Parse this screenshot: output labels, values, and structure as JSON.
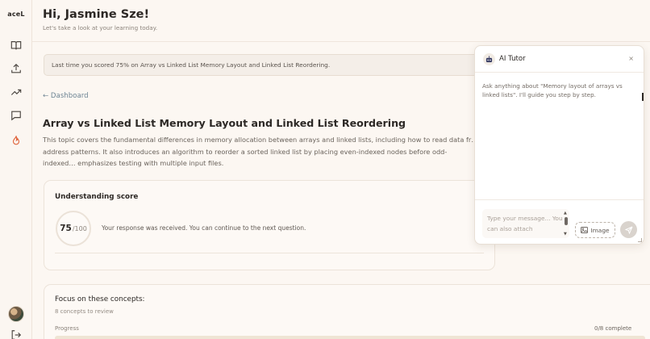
{
  "app": {
    "logo": "aceL"
  },
  "header": {
    "greeting": "Hi, Jasmine Sze!",
    "subtitle": "Let's take a look at your learning today."
  },
  "notice": "Last time you scored 75% on Array vs Linked List Memory Layout and Linked List Reordering.",
  "back_link": "← Dashboard",
  "topic": {
    "title": "Array vs Linked List Memory Layout and Linked List Reordering",
    "description": "This topic covers the fundamental differences in memory allocation between arrays and linked lists, including how to read data fr… address patterns. It also introduces an algorithm to reorder a sorted linked list by placing even-indexed nodes before odd-indexed… emphasizes testing with multiple input files."
  },
  "score_card": {
    "title": "Understanding score",
    "score": "75",
    "max": "/100",
    "message": "Your response was received. You can continue to the next question."
  },
  "concepts": {
    "title": "Focus on these concepts:",
    "subtitle": "8 concepts to review",
    "progress_label": "Progress",
    "progress_count": "0/8 complete",
    "progress_fraction": 0
  },
  "tutor": {
    "title": "AI Tutor",
    "close": "×",
    "intro": "Ask anything about \"Memory layout of arrays vs linked lists\". I'll guide you step by step.",
    "input_placeholder": "Type your message... You can also attach",
    "image_label": "Image"
  },
  "icons": [
    "book-icon",
    "upload-icon",
    "trending-icon",
    "chat-icon",
    "flame-icon",
    "logout-icon",
    "send-icon",
    "image-icon",
    "robot-icon"
  ],
  "colors": {
    "background": "#fcf7f2",
    "flame": "#e0663f",
    "link": "#6e8594",
    "progress": "#efe5d4"
  }
}
